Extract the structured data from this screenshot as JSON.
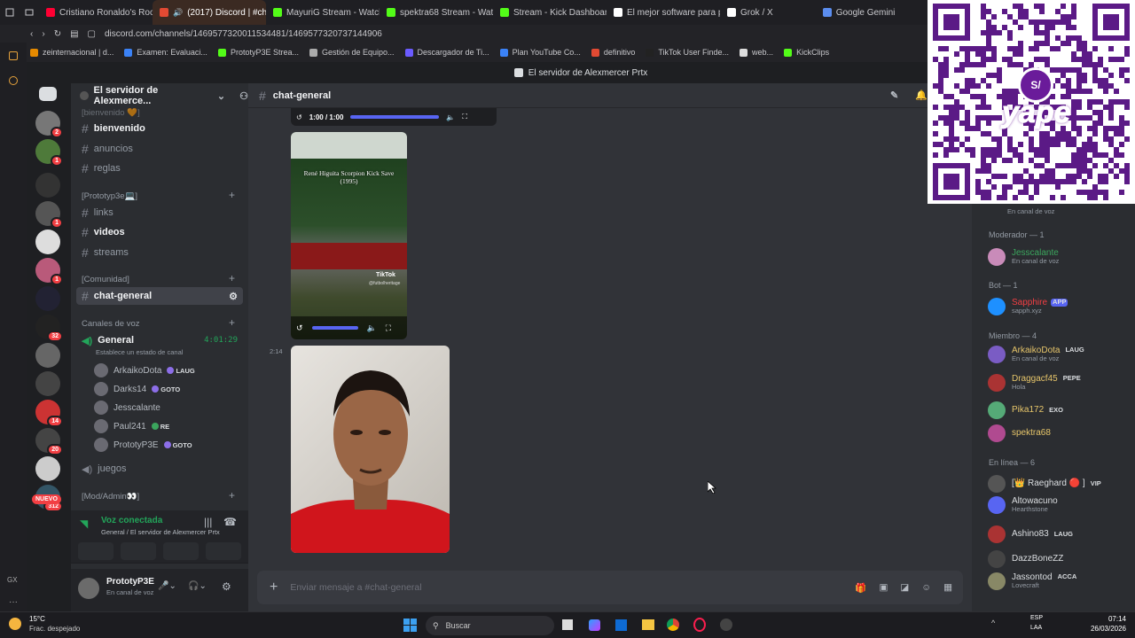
{
  "browser": {
    "tabs": [
      {
        "label": "Cristiano Ronaldo's Rocke",
        "color": "#ff0033"
      },
      {
        "label": "(2017) Discord | #chat",
        "color": "#e24a33",
        "active": true
      },
      {
        "label": "MayuriG Stream - Watch L",
        "color": "#53fc18"
      },
      {
        "label": "spektra68 Stream - Watch",
        "color": "#53fc18"
      },
      {
        "label": "Stream - Kick Dashboard",
        "color": "#53fc18"
      },
      {
        "label": "El mejor software para pc",
        "color": "#ffffff"
      },
      {
        "label": "Grok / X",
        "color": "#ffffff"
      },
      {
        "label": "Google Gemini",
        "color": "#5b8def"
      }
    ],
    "url": "discord.com/channels/1469577320011534481/1469577320737144906",
    "bookmarks": [
      {
        "label": "zeinternacional | d...",
        "color": "#e68a00"
      },
      {
        "label": "Examen: Evaluaci...",
        "color": "#3b82f6"
      },
      {
        "label": "PrototyP3E Strea...",
        "color": "#53fc18"
      },
      {
        "label": "Gestión de Equipo...",
        "color": "#aaaaaa"
      },
      {
        "label": "Descargador de Ti...",
        "color": "#6b5bff"
      },
      {
        "label": "Plan YouTube Co...",
        "color": "#3b82f6"
      },
      {
        "label": "definitivo",
        "color": "#e24a33"
      },
      {
        "label": "TikTok User Finde...",
        "color": "#222222"
      },
      {
        "label": "web...",
        "color": "#dddddd"
      },
      {
        "label": "KickClips",
        "color": "#53fc18"
      }
    ]
  },
  "discord": {
    "window_title": "El servidor de Alexmercer Prtx",
    "server_name": "El servidor de Alexmerce...",
    "server_badges": [
      "2",
      "1",
      "1",
      "1",
      "32",
      "14",
      "20",
      "312"
    ],
    "new_label": "NUEVO",
    "channels_top": {
      "faded_label": "[bienvenido 🧡]",
      "items": [
        {
          "label": "bienvenido",
          "unread": true
        },
        {
          "label": "anuncios",
          "unread": false
        },
        {
          "label": "reglas",
          "unread": false
        }
      ]
    },
    "cat_prototype": "[Prototyp3e💻]",
    "channels_proto": [
      {
        "label": "links",
        "unread": false
      },
      {
        "label": "videos",
        "unread": true
      },
      {
        "label": "streams",
        "unread": false
      }
    ],
    "cat_comunidad": "[Comunidad]",
    "selected_channel": "chat-general",
    "cat_voice": "Canales de voz",
    "voice_channel": {
      "label": "General",
      "timer": "4:01:29",
      "status": "Establece un estado de canal"
    },
    "voice_users": [
      {
        "name": "ArkaikoDota",
        "tag": "LAUG",
        "color": "#8c6ee8"
      },
      {
        "name": "Darks14",
        "tag": "GOTO",
        "color": "#8c6ee8"
      },
      {
        "name": "Jesscalante",
        "tag": "",
        "color": "#8c6ee8"
      },
      {
        "name": "Paul241",
        "tag": "RE",
        "color": "#3ba55d"
      },
      {
        "name": "PrototyP3E",
        "tag": "GOTO",
        "color": "#8c6ee8"
      }
    ],
    "juegos": "juegos",
    "cat_mod": "[Mod/Admin👀]",
    "voice_connected": {
      "status": "Voz conectada",
      "location": "General / El servidor de Alexmercer Prtx"
    },
    "user": {
      "name": "PrototyP3E",
      "status": "En canal de voz"
    },
    "channel_header": "chat-general",
    "media": {
      "time": "1:00 / 1:00",
      "tiktok_title": "René Higuita Scorpion Kick Save (1995)",
      "tiktok_brand": "TikTok",
      "tiktok_handle": "@futbolheritage"
    },
    "message_time": "2:14",
    "composer_placeholder": "Enviar mensaje a #chat-general"
  },
  "members": {
    "groups": [
      {
        "label": "Moderador — 1",
        "items": [
          {
            "name": "Jesscalante",
            "sub": "En canal de voz",
            "color": "#3ba55d",
            "tag": ""
          }
        ]
      },
      {
        "label": "Bot — 1",
        "items": [
          {
            "name": "Sapphire",
            "sub": "sapph.xyz",
            "color": "#f23f43",
            "tag": "APP"
          }
        ]
      },
      {
        "label": "Miembro — 4",
        "items": [
          {
            "name": "ArkaikoDota",
            "sub": "En canal de voz",
            "color": "#e6c56a",
            "tag": "LAUG"
          },
          {
            "name": "Draggacf45",
            "sub": "Hola",
            "color": "#e6c56a",
            "tag": "PEPE"
          },
          {
            "name": "Pika172",
            "sub": "",
            "color": "#e6c56a",
            "tag": "EXO"
          },
          {
            "name": "spektra68",
            "sub": "",
            "color": "#e6c56a",
            "tag": ""
          }
        ]
      },
      {
        "label": "En línea — 6",
        "items": [
          {
            "name": "[👑 Raeghard 🔴 ]",
            "sub": "",
            "color": "#dbdee1",
            "tag": "VIP"
          },
          {
            "name": "Altowacuno",
            "sub": "Hearthstone",
            "color": "#dbdee1",
            "tag": ""
          },
          {
            "name": "Ashino83",
            "sub": "",
            "color": "#dbdee1",
            "tag": "LAUG"
          },
          {
            "name": "DazzBoneZZ",
            "sub": "",
            "color": "#dbdee1",
            "tag": ""
          },
          {
            "name": "Jassontod",
            "sub": "Lovecraft",
            "color": "#dbdee1",
            "tag": "ACCA"
          }
        ]
      }
    ],
    "partial_top": "En canal de voz"
  },
  "overlay": {
    "brand": "yape",
    "symbol": "S/"
  },
  "taskbar": {
    "weather_temp": "15°C",
    "weather_desc": "Frac. despejado",
    "search": "Buscar",
    "lang1": "ESP",
    "lang2": "LAA",
    "time": "07:14",
    "date": "26/03/2026"
  }
}
